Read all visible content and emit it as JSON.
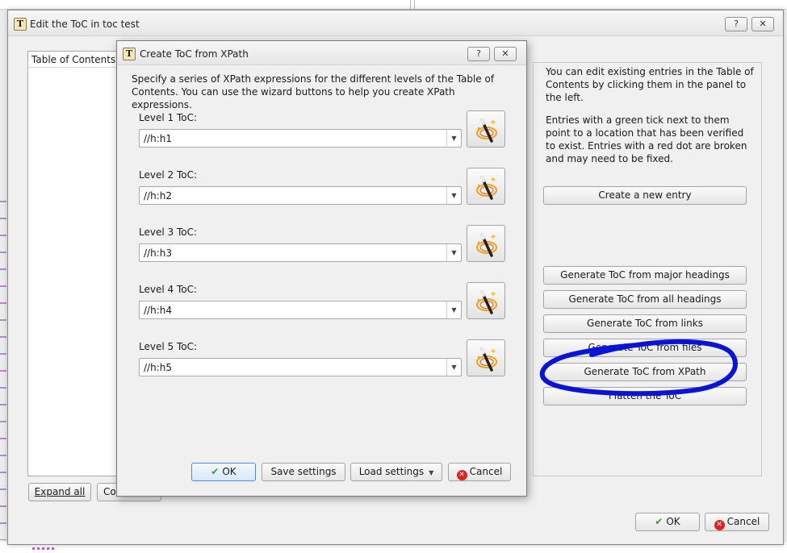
{
  "main_window": {
    "title": "Edit the ToC in toc test",
    "help_btn": "?",
    "close_btn": "✕",
    "toc_header": "Table of Contents",
    "expand_all": "Expand all",
    "collapse_all_partial": "Co",
    "info": {
      "p1": "You can edit existing entries in the Table of Contents by clicking them in the panel to the left.",
      "p2": "Entries with a green tick next to them point to a location that has been verified to exist. Entries with a red dot are broken and may need to be fixed."
    },
    "buttons": {
      "create_new_entry": "Create a new entry",
      "gen_major_headings": "Generate ToC from major headings",
      "gen_all_headings": "Generate ToC from all headings",
      "gen_links": "Generate ToC from links",
      "gen_files": "Generate ToC from files",
      "gen_xpath": "Generate ToC from XPath",
      "flatten": "Flatten the ToC"
    },
    "ok": "OK",
    "cancel": "Cancel"
  },
  "dialog": {
    "title": "Create ToC from XPath",
    "help_btn": "?",
    "close_btn": "✕",
    "description": "Specify a series of XPath expressions for the different levels of the Table of Contents. You can use the wizard buttons to help you create XPath expressions.",
    "levels": [
      {
        "label": "Level 1 ToC:",
        "value": "//h:h1"
      },
      {
        "label": "Level 2 ToC:",
        "value": "//h:h2"
      },
      {
        "label": "Level 3 ToC:",
        "value": "//h:h3"
      },
      {
        "label": "Level 4 ToC:",
        "value": "//h:h4"
      },
      {
        "label": "Level 5 ToC:",
        "value": "//h:h5"
      }
    ],
    "ok": "OK",
    "save_settings": "Save settings",
    "load_settings": "Load settings",
    "cancel": "Cancel"
  },
  "icons": {
    "app": "app-t-icon",
    "wizard": "magic-wand-icon",
    "ok": "green-check-icon",
    "cancel": "red-x-icon",
    "dropdown": "chevron-down-icon"
  },
  "colors": {
    "annotation": "#0a14d6",
    "ok_check": "#2e9e2e",
    "cancel_red": "#d22222",
    "default_button_border": "#4a8bd1"
  }
}
